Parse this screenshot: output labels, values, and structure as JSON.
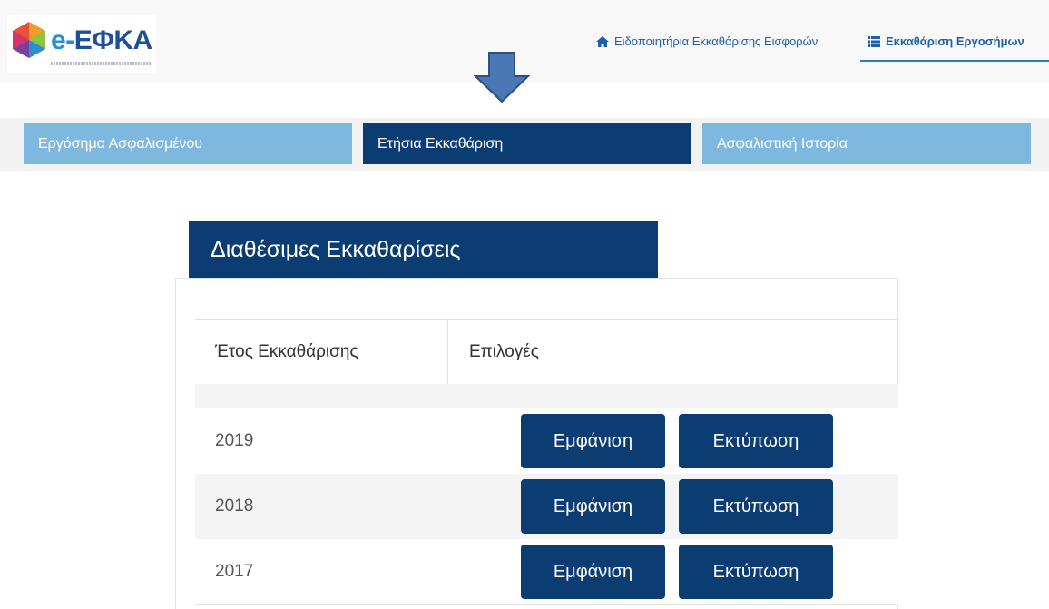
{
  "header": {
    "logo_text_prefix": "e-",
    "logo_text": "ΕΦΚΑ",
    "nav": [
      {
        "label": "Ειδοποιητήρια Εκκαθάρισης Εισφορών",
        "icon": "home-icon"
      },
      {
        "label": "Εκκαθάριση Εργοσήμων",
        "icon": "list-icon"
      }
    ]
  },
  "tabs": [
    {
      "label": "Εργόσημα Ασφαλισμένου",
      "active": false
    },
    {
      "label": "Ετήσια Εκκαθάριση",
      "active": true
    },
    {
      "label": "Ασφαλιστική Ιστορία",
      "active": false
    }
  ],
  "panel": {
    "title": "Διαθέσιμες Εκκαθαρίσεις",
    "columns": [
      "Έτος Εκκαθάρισης",
      "Επιλογές"
    ],
    "rows": [
      {
        "year": "2019",
        "view_label": "Εμφάνιση",
        "print_label": "Εκτύπωση"
      },
      {
        "year": "2018",
        "view_label": "Εμφάνιση",
        "print_label": "Εκτύπωση"
      },
      {
        "year": "2017",
        "view_label": "Εμφάνιση",
        "print_label": "Εκτύπωση"
      }
    ]
  },
  "colors": {
    "primary_dark": "#0c3d72",
    "tab_light": "#7fb8de",
    "link": "#1e5fa8",
    "arrow": "#4a78b5"
  }
}
